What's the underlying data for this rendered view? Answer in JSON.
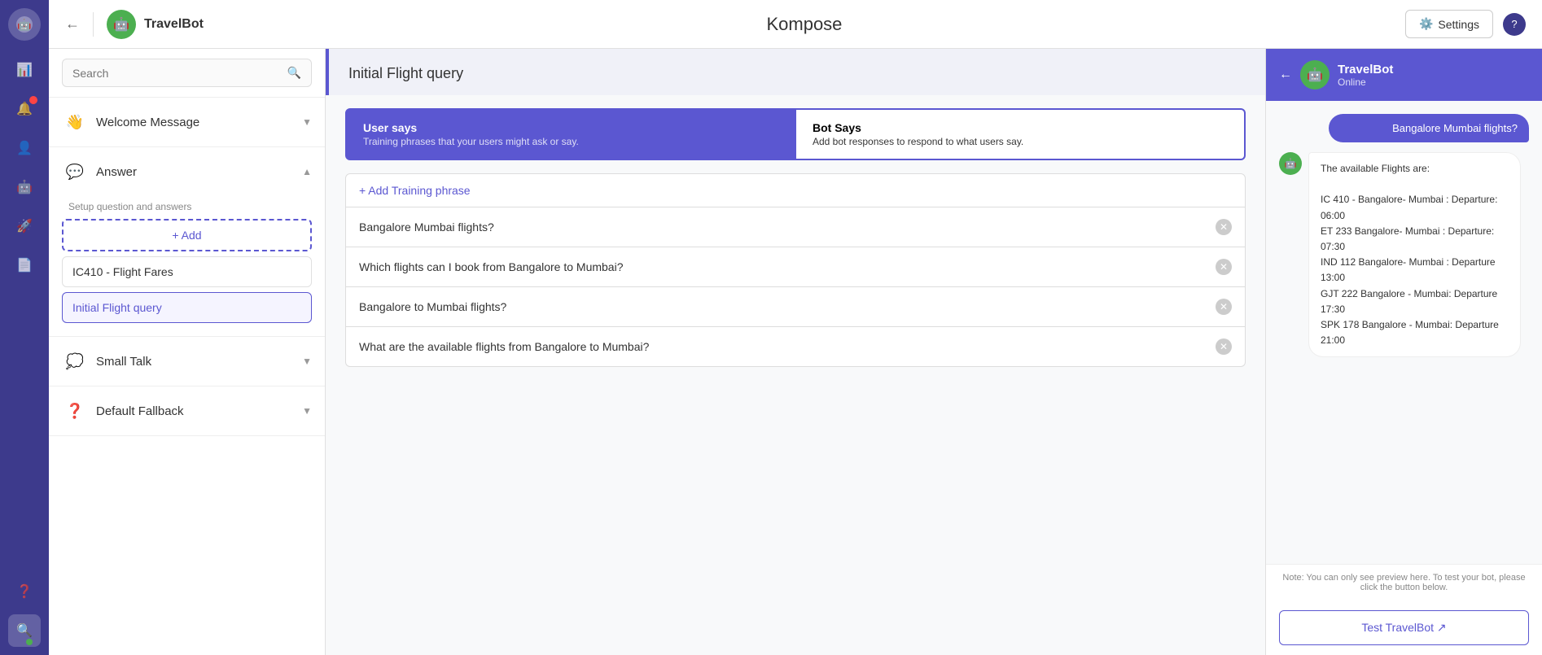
{
  "app": {
    "title": "Kompose",
    "bot_name": "TravelBot",
    "settings_label": "Settings",
    "help": "?"
  },
  "left_nav": {
    "items": [
      {
        "name": "chat-icon",
        "icon": "💬",
        "active": false
      },
      {
        "name": "bar-chart-icon",
        "icon": "📊",
        "active": false
      },
      {
        "name": "notification-icon",
        "icon": "🔔",
        "active": false,
        "badge": true
      },
      {
        "name": "user-icon",
        "icon": "👤",
        "active": false
      },
      {
        "name": "bot-icon",
        "icon": "🤖",
        "active": false
      },
      {
        "name": "rocket-icon",
        "icon": "🚀",
        "active": false
      },
      {
        "name": "document-icon",
        "icon": "📄",
        "active": false
      }
    ],
    "bottom": [
      {
        "name": "question-icon",
        "icon": "❓"
      },
      {
        "name": "search-bottom-icon",
        "icon": "🔍",
        "active": true
      }
    ]
  },
  "sidebar": {
    "search_placeholder": "Search",
    "sections": [
      {
        "id": "welcome",
        "icon": "👋",
        "label": "Welcome Message",
        "expanded": false
      },
      {
        "id": "answer",
        "icon": "💬",
        "label": "Answer",
        "sub_text": "Setup question and answers",
        "expanded": true,
        "add_btn_label": "+ Add",
        "items": [
          {
            "id": "ic410",
            "label": "IC410 - Flight Fares",
            "active": false
          },
          {
            "id": "initial-flight",
            "label": "Initial Flight query",
            "active": true
          }
        ]
      },
      {
        "id": "small-talk",
        "icon": "💭",
        "label": "Small Talk",
        "expanded": false
      },
      {
        "id": "default-fallback",
        "icon": "❓",
        "label": "Default Fallback",
        "expanded": false
      }
    ]
  },
  "content": {
    "title": "Initial Flight query",
    "tabs": [
      {
        "id": "user-says",
        "title": "User says",
        "desc": "Training phrases that your users might ask or say.",
        "active": true
      },
      {
        "id": "bot-says",
        "title": "Bot Says",
        "desc": "Add bot responses to respond to what users say.",
        "active": false
      }
    ],
    "add_phrase_label": "+ Add Training phrase",
    "phrases": [
      {
        "id": 1,
        "text": "Bangalore Mumbai flights?"
      },
      {
        "id": 2,
        "text": "Which flights can I book from Bangalore to Mumbai?"
      },
      {
        "id": 3,
        "text": "Bangalore to Mumbai flights?"
      },
      {
        "id": 4,
        "text": "What are the available flights from Bangalore to Mumbai?"
      }
    ]
  },
  "preview": {
    "bot_name": "TravelBot",
    "bot_status": "Online",
    "user_message": "Bangalore Mumbai flights?",
    "bot_response": "The available Flights are:\n\nIC 410 - Bangalore- Mumbai : Departure: 06:00\nET 233 Bangalore- Mumbai : Departure: 07:30\nIND 112 Bangalore- Mumbai : Departure 13:00\nGJT 222 Bangalore - Mumbai: Departure 17:30\nSPK 178 Bangalore - Mumbai: Departure 21:00",
    "note": "Note: You can only see preview here. To test your bot, please click the button below.",
    "test_btn_label": "Test TravelBot ↗"
  }
}
